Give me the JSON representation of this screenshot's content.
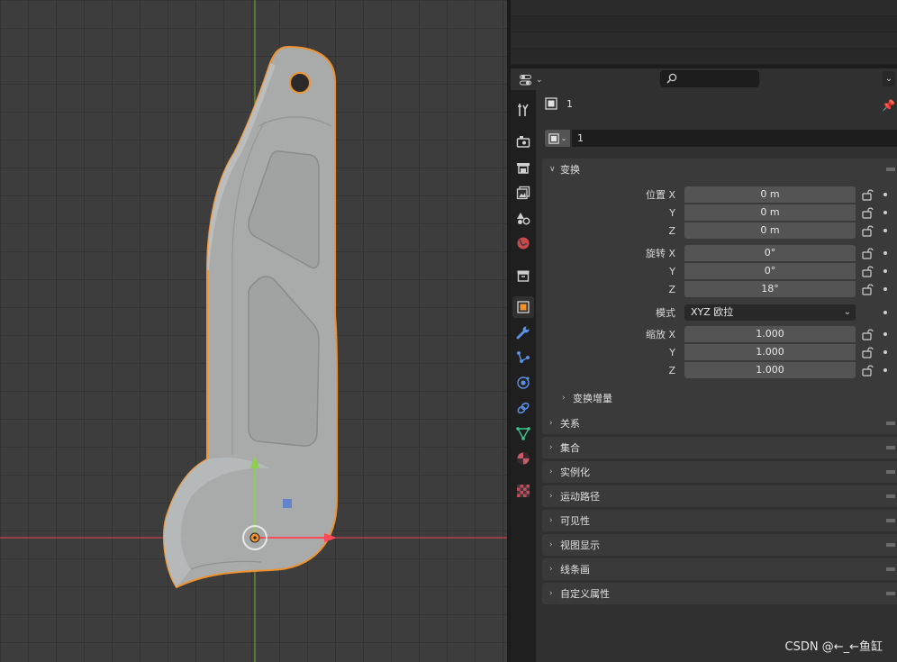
{
  "viewport": {
    "x_axis_color": "#c8414d",
    "y_axis_color": "#6c9d34",
    "selection_outline": "#f0922e"
  },
  "properties": {
    "header": {
      "editor_icon": "properties-editor-icon",
      "search_placeholder": ""
    },
    "tabs": [
      {
        "name": "tool",
        "icon": "tool-icon"
      },
      {
        "name": "render",
        "icon": "render-icon"
      },
      {
        "name": "output",
        "icon": "output-icon"
      },
      {
        "name": "view-layer",
        "icon": "view-layer-icon"
      },
      {
        "name": "scene",
        "icon": "scene-icon"
      },
      {
        "name": "world",
        "icon": "world-icon"
      },
      {
        "name": "collection",
        "icon": "collection-icon"
      },
      {
        "name": "object",
        "icon": "object-icon",
        "active": true
      },
      {
        "name": "modifiers",
        "icon": "wrench-icon"
      },
      {
        "name": "particles",
        "icon": "particles-icon"
      },
      {
        "name": "physics",
        "icon": "physics-icon"
      },
      {
        "name": "constraints",
        "icon": "constraints-icon"
      },
      {
        "name": "data",
        "icon": "mesh-data-icon"
      },
      {
        "name": "material",
        "icon": "material-icon"
      },
      {
        "name": "texture",
        "icon": "texture-icon"
      }
    ],
    "object_name": "1",
    "datablock_name": "1",
    "transform": {
      "title": "变换",
      "location_label": "位置 X",
      "rotation_label": "旋转 X",
      "scale_label": "缩放 X",
      "mode_label": "模式",
      "y_label": "Y",
      "z_label": "Z",
      "location": [
        "0 m",
        "0 m",
        "0 m"
      ],
      "rotation": [
        "0°",
        "0°",
        "18°"
      ],
      "mode": "XYZ 欧拉",
      "scale": [
        "1.000",
        "1.000",
        "1.000"
      ],
      "delta_title": "变换增量"
    },
    "panels": [
      "关系",
      "集合",
      "实例化",
      "运动路径",
      "可见性",
      "视图显示",
      "线条画",
      "自定义属性"
    ]
  },
  "watermark": "CSDN @←_←鱼缸"
}
